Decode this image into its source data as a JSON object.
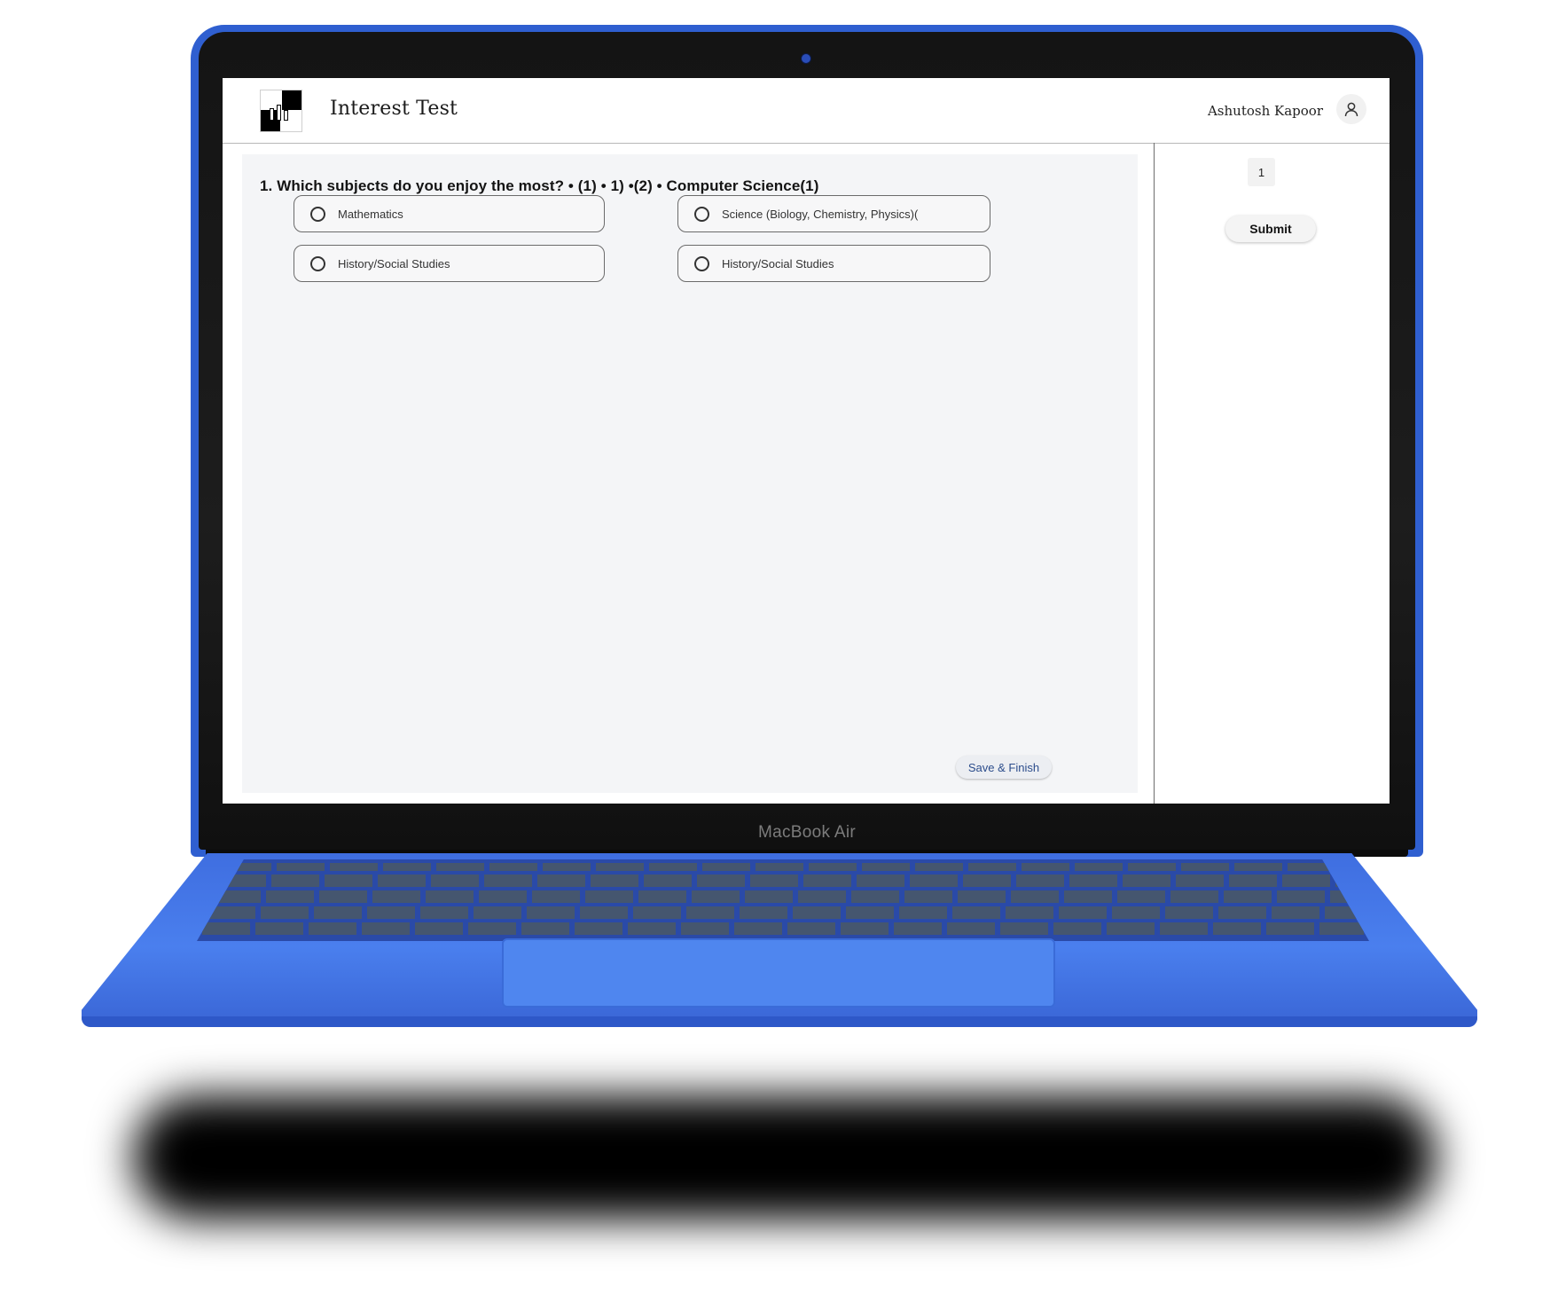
{
  "app": {
    "title": "Interest Test",
    "user_name": "Ashutosh Kapoor"
  },
  "question": {
    "text": "1. Which subjects do you enjoy the most? • (1) • 1) •(2) • Computer Science(1)",
    "options": [
      "Mathematics",
      "Science (Biology, Chemistry, Physics)(",
      "History/Social Studies",
      "History/Social Studies"
    ]
  },
  "actions": {
    "save_finish_label": "Save & Finish",
    "submit_label": "Submit"
  },
  "sidebar": {
    "question_numbers": [
      "1"
    ]
  },
  "device": {
    "brand_label": "MacBook Air"
  },
  "icons": {
    "user": "user-icon",
    "radio": "radio-empty-icon",
    "logo": "app-logo"
  },
  "colors": {
    "laptop_body": "#3f6ee0",
    "panel_bg": "#f4f5f7",
    "save_text": "#2c4d8c"
  }
}
